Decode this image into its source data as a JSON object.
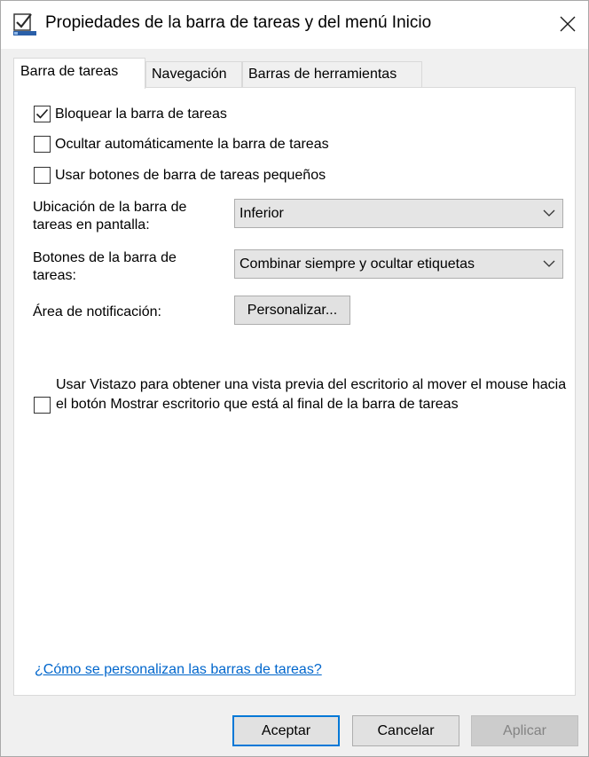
{
  "window": {
    "title": "Propiedades de la barra de tareas y del menú Inicio",
    "icon": "taskbar-properties-icon",
    "close_icon": "close-icon"
  },
  "tabs": [
    {
      "label": "Barra de tareas",
      "active": true
    },
    {
      "label": "Navegación",
      "active": false
    },
    {
      "label": "Barras de herramientas",
      "active": false
    }
  ],
  "options": {
    "lock_taskbar": {
      "label": "Bloquear la barra de tareas",
      "checked": true
    },
    "auto_hide": {
      "label": "Ocultar automáticamente la barra de tareas",
      "checked": false
    },
    "small_buttons": {
      "label": "Usar botones de barra de tareas pequeños",
      "checked": false
    }
  },
  "location": {
    "label_line1": "Ubicación de la barra de",
    "label_line2": "tareas en pantalla:",
    "value": "Inferior"
  },
  "buttons_setting": {
    "label_line1": "Botones de la barra de",
    "label_line2": "tareas:",
    "value": "Combinar siempre y ocultar etiquetas"
  },
  "notification_area": {
    "label": "Área de notificación:",
    "button_label": "Personalizar..."
  },
  "peek": {
    "label": "Usar Vistazo para obtener una vista previa del escritorio al mover el mouse hacia el botón Mostrar escritorio que está al final de la barra de tareas",
    "checked": false
  },
  "help_link": "¿Cómo se personalizan las barras de tareas?",
  "footer": {
    "ok_label": "Aceptar",
    "cancel_label": "Cancelar",
    "apply_label": "Aplicar"
  },
  "colors": {
    "accent": "#0078d7",
    "link": "#0066cc",
    "disabled_text": "#838383"
  }
}
